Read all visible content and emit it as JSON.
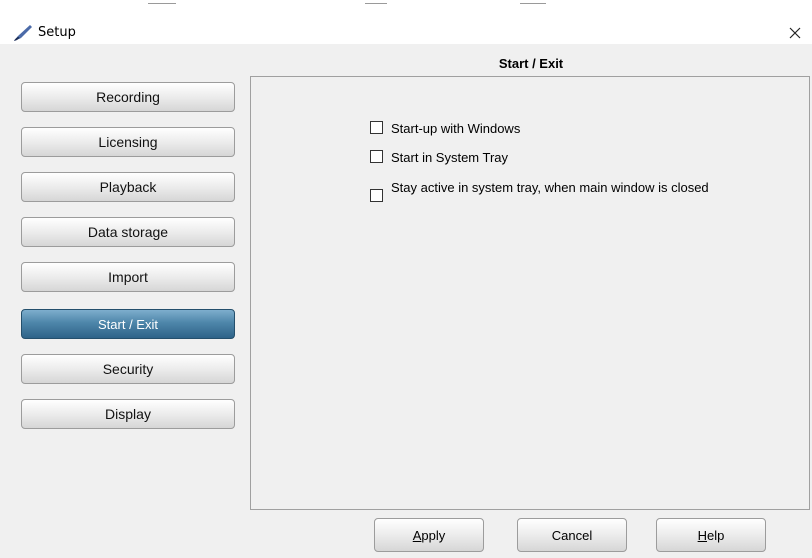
{
  "window": {
    "title": "Setup",
    "close_glyph": "×"
  },
  "sidebar": {
    "items": [
      {
        "label": "Recording"
      },
      {
        "label": "Licensing"
      },
      {
        "label": "Playback"
      },
      {
        "label": "Data storage"
      },
      {
        "label": "Import"
      },
      {
        "label": "Start / Exit",
        "selected": true
      },
      {
        "label": "Security"
      },
      {
        "label": "Display"
      }
    ]
  },
  "panel": {
    "title": "Start / Exit",
    "options": [
      {
        "label": "Start-up with Windows",
        "checked": false
      },
      {
        "label": "Start in System Tray",
        "checked": false
      },
      {
        "label": "Stay active in system tray, when main window is closed",
        "checked": false
      }
    ]
  },
  "footer": {
    "apply": {
      "mnemonic": "A",
      "rest": "pply"
    },
    "cancel": "Cancel",
    "help": {
      "mnemonic": "H",
      "rest": "elp"
    }
  },
  "icons": {
    "app": "brush-icon",
    "close": "close-icon"
  },
  "colors": {
    "active_item": "#3f77a0",
    "panel_bg": "#f0f0f0",
    "border": "#a0a0a0"
  }
}
